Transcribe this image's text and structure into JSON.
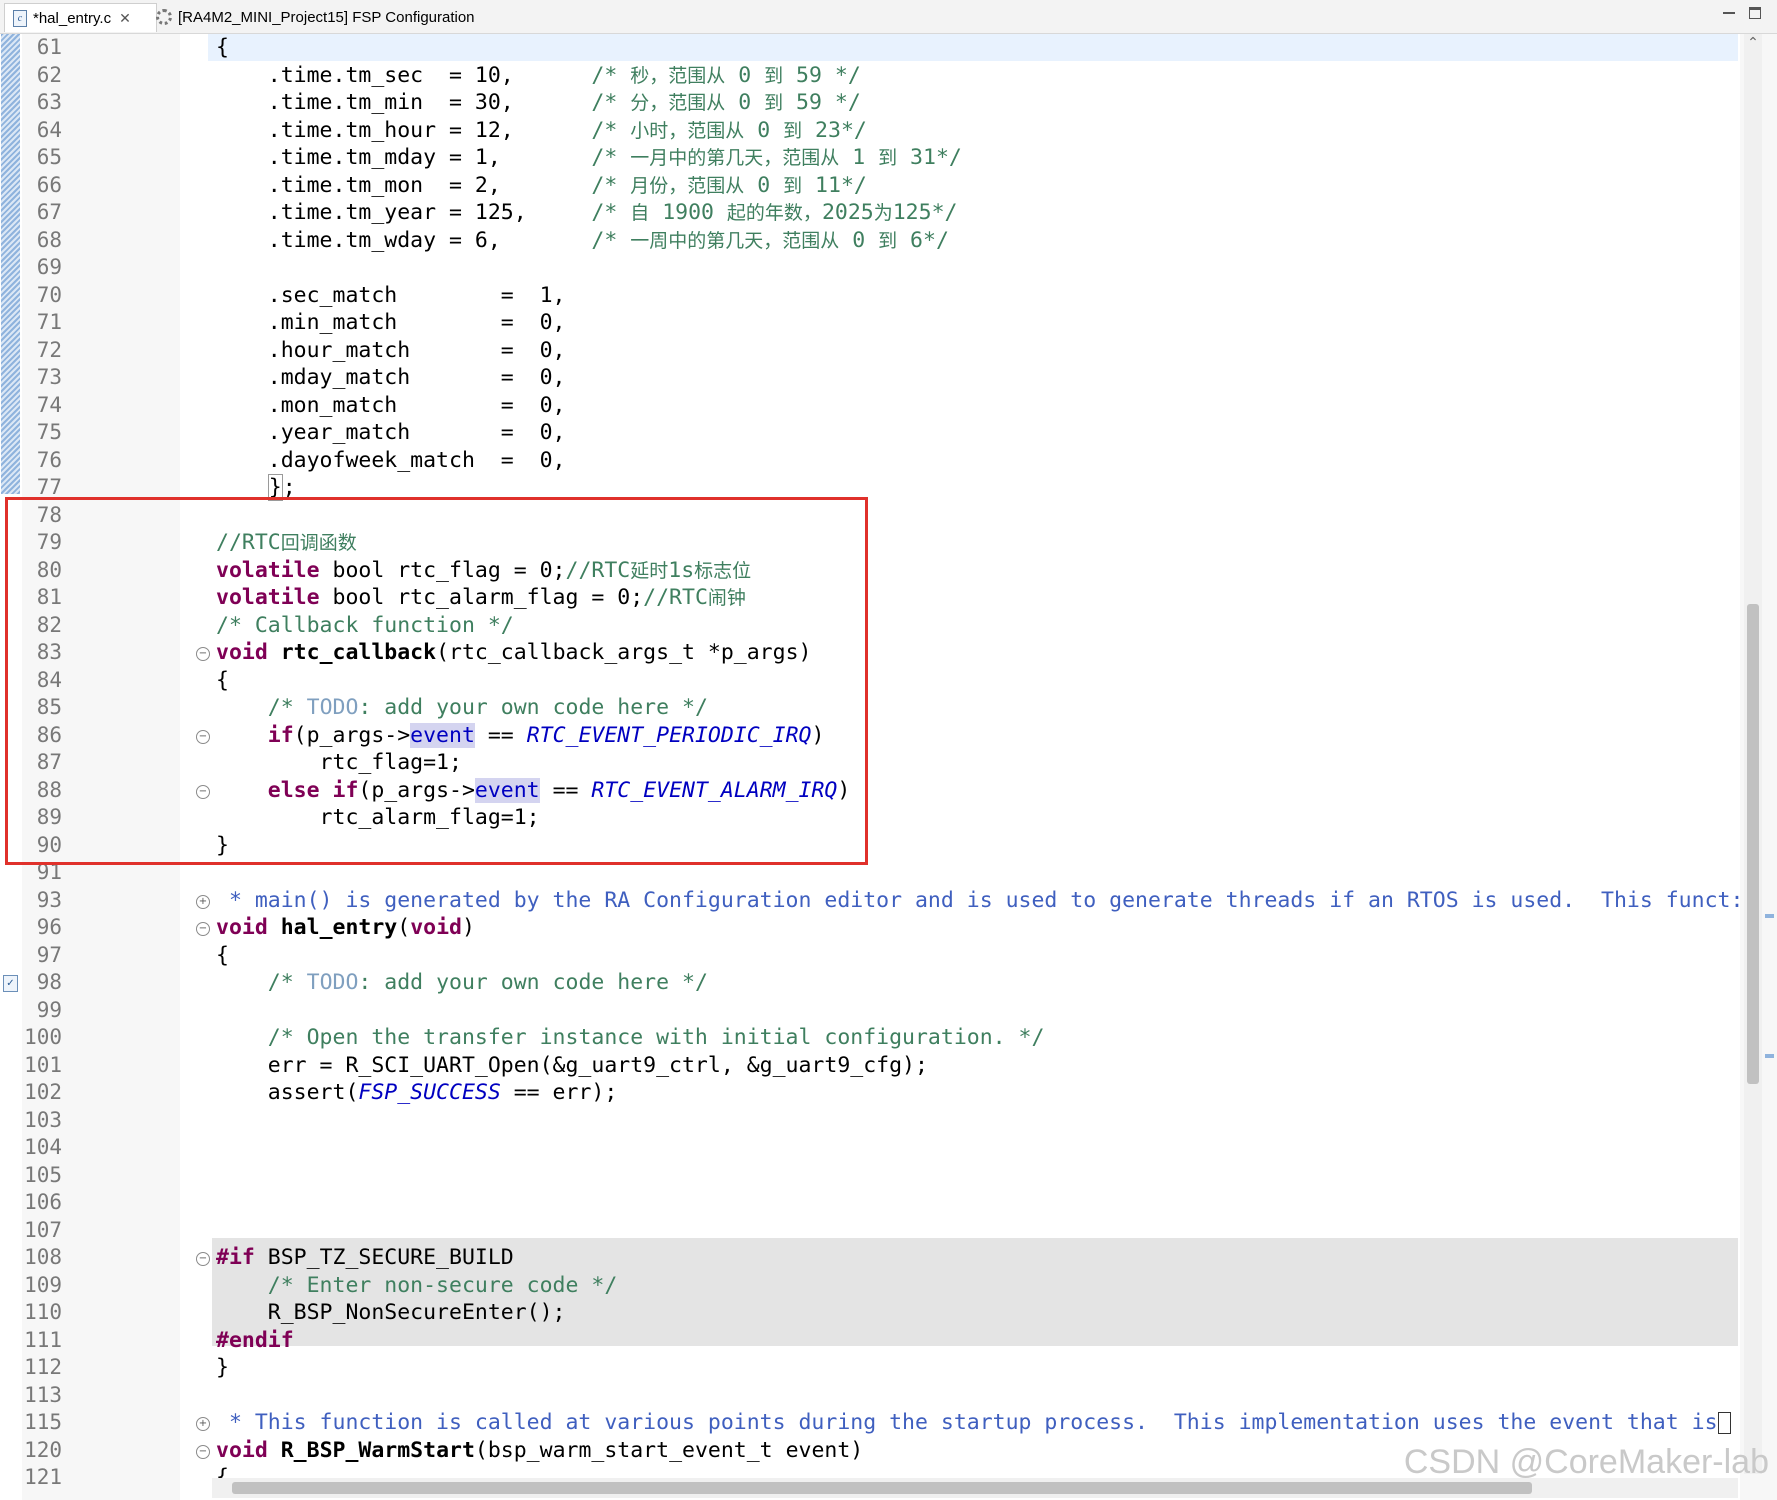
{
  "tabs": [
    {
      "label": "*hal_entry.c",
      "icon": "c-file-icon",
      "active": true
    },
    {
      "label": "[RA4M2_MINI_Project15] FSP Configuration",
      "icon": "gear-icon",
      "active": false
    }
  ],
  "lines": [
    {
      "n": "61",
      "html": "<span>{</span>"
    },
    {
      "n": "62",
      "html": "<span>    .time.tm_sec  = 10,      </span><span class=\"cm\">/* <span class=\"cjk\">秒，范围从</span> 0 <span class=\"cjk\">到</span> 59 */</span>"
    },
    {
      "n": "63",
      "html": "<span>    .time.tm_min  = 30,      </span><span class=\"cm\">/* <span class=\"cjk\">分，范围从</span> 0 <span class=\"cjk\">到</span> 59 */</span>"
    },
    {
      "n": "64",
      "html": "<span>    .time.tm_hour = 12,      </span><span class=\"cm\">/* <span class=\"cjk\">小时，范围从</span> 0 <span class=\"cjk\">到</span> 23*/</span>"
    },
    {
      "n": "65",
      "html": "<span>    .time.tm_mday = 1,       </span><span class=\"cm\">/* <span class=\"cjk\">一月中的第几天，范围从</span> 1 <span class=\"cjk\">到</span> 31*/</span>"
    },
    {
      "n": "66",
      "html": "<span>    .time.tm_mon  = 2,       </span><span class=\"cm\">/* <span class=\"cjk\">月份，范围从</span> 0 <span class=\"cjk\">到</span> 11*/</span>"
    },
    {
      "n": "67",
      "html": "<span>    .time.tm_year = 125,     </span><span class=\"cm\">/* <span class=\"cjk\">自</span> 1900 <span class=\"cjk\">起的年数，</span>2025<span class=\"cjk\">为</span>125*/</span>"
    },
    {
      "n": "68",
      "html": "<span>    .time.tm_wday = 6,       </span><span class=\"cm\">/* <span class=\"cjk\">一周中的第几天，范围从</span> 0 <span class=\"cjk\">到</span> 6*/</span>"
    },
    {
      "n": "69",
      "html": ""
    },
    {
      "n": "70",
      "html": "<span>    .sec_match        =  1,</span>"
    },
    {
      "n": "71",
      "html": "<span>    .min_match        =  0,</span>"
    },
    {
      "n": "72",
      "html": "<span>    .hour_match       =  0,</span>"
    },
    {
      "n": "73",
      "html": "<span>    .mday_match       =  0,</span>"
    },
    {
      "n": "74",
      "html": "<span>    .mon_match        =  0,</span>"
    },
    {
      "n": "75",
      "html": "<span>    .year_match       =  0,</span>"
    },
    {
      "n": "76",
      "html": "<span>    .dayofweek_match  =  0,</span>"
    },
    {
      "n": "77",
      "html": "<span>    <span class=\"bracket-box\">}</span>;</span>"
    },
    {
      "n": "78",
      "html": ""
    },
    {
      "n": "79",
      "html": "<span class=\"cm\">//RTC<span class=\"cjk\">回调函数</span></span>"
    },
    {
      "n": "80",
      "html": "<span class=\"kw\">volatile</span> bool rtc_flag = 0;<span class=\"cm\">//RTC<span class=\"cjk\">延时</span>1s<span class=\"cjk\">标志位</span></span>"
    },
    {
      "n": "81",
      "html": "<span class=\"kw\">volatile</span> bool rtc_alarm_flag = 0;<span class=\"cm\">//RTC<span class=\"cjk\">闹钟</span></span>"
    },
    {
      "n": "82",
      "html": "<span class=\"cm\">/* Callback function */</span>"
    },
    {
      "n": "83",
      "html": "<span class=\"kw\">void</span> <span class=\"fn\">rtc_callback</span>(rtc_callback_args_t *p_args)",
      "fold": "minus"
    },
    {
      "n": "84",
      "html": "{"
    },
    {
      "n": "85",
      "html": "    <span class=\"cm\">/* <span class=\"todo\">TODO</span>: add your own code here */</span>"
    },
    {
      "n": "86",
      "html": "    <span class=\"kw\">if</span>(p_args-><span class=\"occ\">event</span> == <span class=\"mac\">RTC_EVENT_PERIODIC_IRQ</span>)",
      "fold": "minus"
    },
    {
      "n": "87",
      "html": "        rtc_flag=1;"
    },
    {
      "n": "88",
      "html": "    <span class=\"kw\">else</span> <span class=\"kw\">if</span>(p_args-><span class=\"occ\">event</span> == <span class=\"mac\">RTC_EVENT_ALARM_IRQ</span>)",
      "fold": "minus"
    },
    {
      "n": "89",
      "html": "        rtc_alarm_flag=1;"
    },
    {
      "n": "90",
      "html": "}"
    },
    {
      "n": "91",
      "html": ""
    },
    {
      "n": "93",
      "html": "<span class=\"doc\"> * main() is generated by the RA Configuration editor and is used to generate threads if an RTOS is used.  This funct:</span>",
      "fold": "plus"
    },
    {
      "n": "96",
      "html": "<span class=\"kw\">void</span> <span class=\"fn\">hal_entry</span>(<span class=\"kw\">void</span>)",
      "fold": "minus"
    },
    {
      "n": "97",
      "html": "{"
    },
    {
      "n": "98",
      "html": "    <span class=\"cm\">/* <span class=\"todo\">TODO</span>: add your own code here */</span>",
      "task": true
    },
    {
      "n": "99",
      "html": ""
    },
    {
      "n": "100",
      "html": "    <span class=\"cm\">/* Open the transfer instance with initial configuration. */</span>"
    },
    {
      "n": "101",
      "html": "    err = R_SCI_UART_Open(&amp;g_uart9_ctrl, &amp;g_uart9_cfg);"
    },
    {
      "n": "102",
      "html": "    assert(<span class=\"mac\">FSP_SUCCESS</span> == err);"
    },
    {
      "n": "103",
      "html": ""
    },
    {
      "n": "104",
      "html": ""
    },
    {
      "n": "105",
      "html": ""
    },
    {
      "n": "106",
      "html": ""
    },
    {
      "n": "107",
      "html": ""
    },
    {
      "n": "108",
      "html": "<span class=\"kw\">#if</span> BSP_TZ_SECURE_BUILD",
      "fold": "minus"
    },
    {
      "n": "109",
      "html": "    <span class=\"cm\">/* Enter non-secure code */</span>"
    },
    {
      "n": "110",
      "html": "    R_BSP_NonSecureEnter();"
    },
    {
      "n": "111",
      "html": "<span class=\"kw\">#endif</span>"
    },
    {
      "n": "112",
      "html": "}"
    },
    {
      "n": "113",
      "html": ""
    },
    {
      "n": "115",
      "html": "<span class=\"doc\"> * This function is called at various points during the startup process.  This implementation uses the event that is</span><span class=\"caret-box\"></span>",
      "fold": "plus"
    },
    {
      "n": "120",
      "html": "<span class=\"kw\">void</span> <span class=\"fn\">R_BSP_WarmStart</span>(bsp_warm_start_event_t event)",
      "fold": "minus"
    },
    {
      "n": "121",
      "html": "{"
    }
  ],
  "watermark": "CSDN @CoreMaker-lab",
  "colors": {
    "keyword": "#7f0055",
    "comment": "#3f7f5f",
    "javadoc": "#3f5fbf",
    "macro": "#0000c0",
    "highlight_box": "#e0312b"
  },
  "icons": [
    "c-file-icon",
    "close-icon",
    "gear-icon",
    "minimize-icon",
    "maximize-icon",
    "fold-minus-icon",
    "fold-plus-icon",
    "task-icon",
    "scroll-up-icon",
    "scroll-down-icon",
    "scroll-left-icon",
    "scroll-right-icon"
  ]
}
